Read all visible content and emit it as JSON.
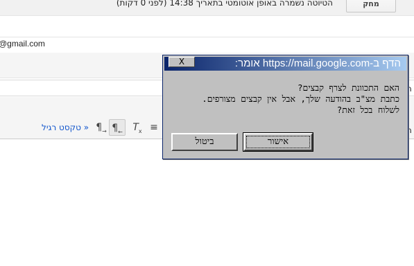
{
  "compose": {
    "draft_status": "הטיוטה נשמרה באופן אוטומטי בתאריך 14:38 (לפני 0 דקות)",
    "discard_label": "מחק",
    "to_value": "@gmail.com",
    "edge_char_1": "ה",
    "edge_char_2": "ה",
    "edge_char_3": "ו",
    "plain_text_label": "« טקסט רגיל",
    "toolbar": {
      "rtl_icon": "paragraph-rtl-icon",
      "ltr_icon": "paragraph-ltr-icon",
      "clear_format_icon": "clear-format-icon",
      "align_icon": "align-icon"
    }
  },
  "dialog": {
    "title": "הדף ב-https://mail.google.com אומר:",
    "close_label": "X",
    "message_lines": [
      "האם התכוונת לצרף קבצים?",
      "כתבת מצ\"ב בהודעה שלך, אבל אין קבצים מצורפים.",
      "לשלוח בכל זאת?"
    ],
    "ok_label": "אישור",
    "cancel_label": "ביטול"
  }
}
